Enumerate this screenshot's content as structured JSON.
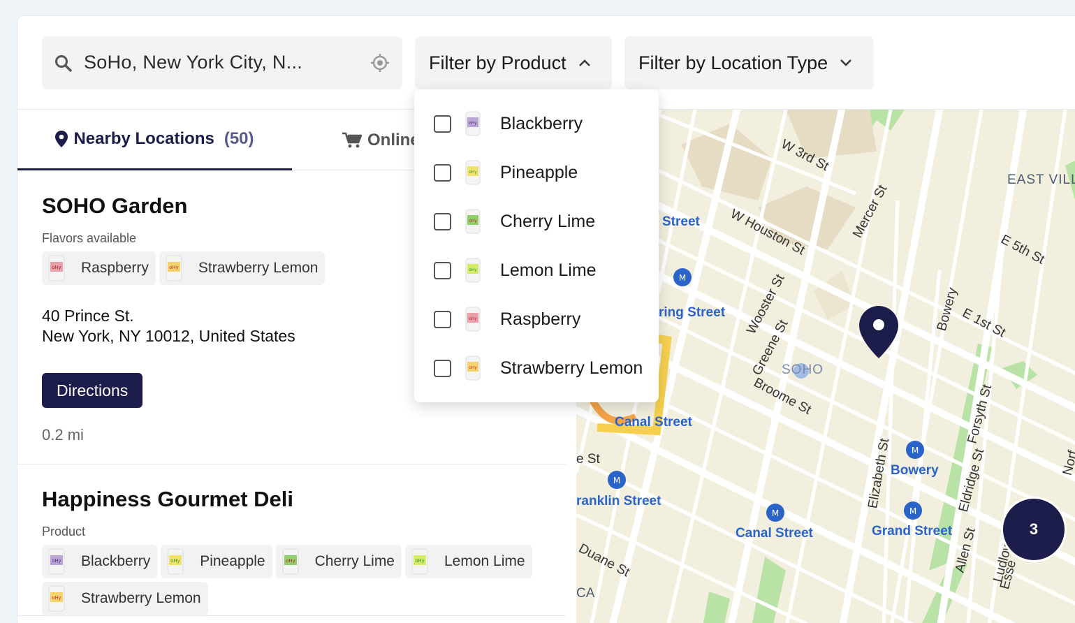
{
  "search": {
    "value": "SoHo, New York City, N..."
  },
  "filters": {
    "product_label": "Filter by Product",
    "location_type_label": "Filter by Location Type",
    "product_options": [
      "Blackberry",
      "Pineapple",
      "Cherry Lime",
      "Lemon Lime",
      "Raspberry",
      "Strawberry Lemon"
    ]
  },
  "tabs": {
    "nearby_label": "Nearby Locations",
    "nearby_count": "(50)",
    "online_label": "Online"
  },
  "locations": [
    {
      "name": "SOHO Garden",
      "flavors_label": "Flavors available",
      "flavors": [
        "Raspberry",
        "Strawberry Lemon"
      ],
      "address_line1": "40 Prince St.",
      "address_line2": "New York, NY 10012, United States",
      "directions_label": "Directions",
      "distance": "0.2 mi"
    },
    {
      "name": "Happiness Gourmet Deli",
      "flavors_label": "Product",
      "flavors": [
        "Blackberry",
        "Pineapple",
        "Cherry Lime",
        "Lemon Lime",
        "Strawberry Lemon"
      ]
    }
  ],
  "map": {
    "labels": {
      "w3rd": "W 3rd St",
      "east_vill": "EAST VILL",
      "street": "Street",
      "w_houston": "W Houston St",
      "mercer": "Mercer St",
      "e5th": "E 5th St",
      "spring_street": "ring Street",
      "wooster": "Wooster St",
      "bowery_st": "Bowery",
      "e1st": "E 1st St",
      "greene": "Greene St",
      "soho": "SOHO",
      "broome": "Broome St",
      "canal_street_w": "Canal Street",
      "forsyth": "Forsyth St",
      "e_st": "e St",
      "elizabeth": "Elizabeth St",
      "bowery_station": "Bowery",
      "eldridge": "Eldridge St",
      "franklin_street": "ranklin Street",
      "canal_street_e": "Canal Street",
      "grand_street": "Grand Street",
      "allen": "Allen St",
      "duane": "Duane St",
      "ca": "CA",
      "ludlow": "Ludlow St",
      "essex": "Esse",
      "norf": "Norf"
    },
    "cluster_count": "3"
  },
  "colors": {
    "brand": "#1c1d4a",
    "transit": "#2b64c8",
    "park": "#b9e3a6"
  },
  "icons": [
    "search-icon",
    "locate-icon",
    "chevron-up-icon",
    "chevron-down-icon",
    "location-pin-icon",
    "cart-icon",
    "map-pin-icon",
    "subway-icon"
  ]
}
